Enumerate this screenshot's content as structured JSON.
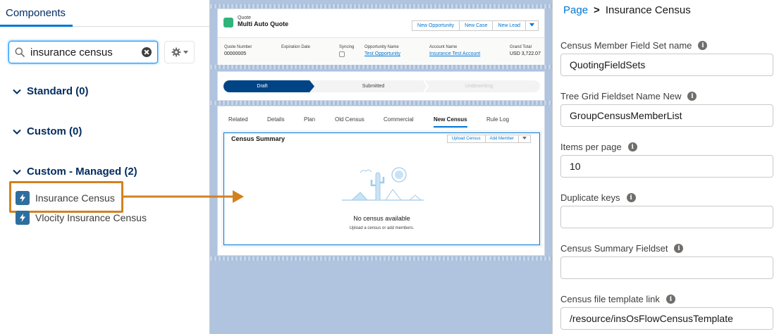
{
  "left": {
    "tab_label": "Components",
    "search": {
      "value": "insurance census",
      "placeholder": ""
    },
    "sections": [
      {
        "label": "Standard (0)"
      },
      {
        "label": "Custom (0)"
      },
      {
        "label": "Custom - Managed (2)"
      }
    ],
    "components": [
      {
        "label": "Insurance Census"
      },
      {
        "label": "Vlocity Insurance Census"
      }
    ]
  },
  "canvas": {
    "header": {
      "object_label": "Quote",
      "record_title": "Multi Auto Quote",
      "buttons": [
        "New Opportunity",
        "New Case",
        "New Lead"
      ]
    },
    "fields": [
      {
        "label": "Quote Number",
        "value": "00000005"
      },
      {
        "label": "Expiration Date",
        "value": ""
      },
      {
        "label": "Syncing",
        "value": ""
      },
      {
        "label": "Opportunity Name",
        "value": "Test Opportunity"
      },
      {
        "label": "Account Name",
        "value": "Insurance Test Account"
      },
      {
        "label": "Grand Total",
        "value": "USD 3,722.07"
      }
    ],
    "path": [
      "Draft",
      "Submitted",
      "Underwriting"
    ],
    "tabs": [
      "Related",
      "Details",
      "Plan",
      "Old Census",
      "Commercial",
      "New Census",
      "Rule Log"
    ],
    "summary": {
      "title": "Census Summary",
      "buttons": [
        "Upload Census",
        "Add Member"
      ],
      "empty_title": "No census available",
      "empty_sub": "Upload a census or add members."
    }
  },
  "right": {
    "breadcrumb": {
      "root": "Page",
      "current": "Insurance Census"
    },
    "properties": [
      {
        "label": "Census Member Field Set name",
        "value": "QuotingFieldSets"
      },
      {
        "label": "Tree Grid Fieldset Name New",
        "value": "GroupCensusMemberList"
      },
      {
        "label": "Items per page",
        "value": "10"
      },
      {
        "label": "Duplicate keys",
        "value": ""
      },
      {
        "label": "Census Summary Fieldset",
        "value": ""
      },
      {
        "label": "Census file template link",
        "value": "/resource/insOsFlowCensusTemplate"
      }
    ]
  },
  "colors": {
    "accent": "#0176d3",
    "highlight": "#d2811f",
    "canvas_bg": "#b0c4df",
    "component_icon": "#2e6e9e"
  }
}
